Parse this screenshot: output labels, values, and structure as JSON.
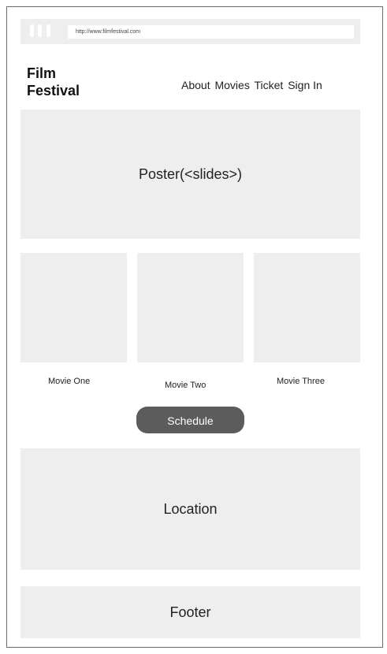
{
  "browser": {
    "url": "http://www.filmfestival.com"
  },
  "header": {
    "logo_line1": "Film",
    "logo_line2": "Festival",
    "nav": [
      "About",
      "Movies",
      "Ticket",
      "Sign In"
    ]
  },
  "poster": {
    "label": "Poster(<slides>)"
  },
  "movies": [
    "Movie One",
    "Movie Two",
    "Movie Three"
  ],
  "schedule_label": "Schedule",
  "location_label": "Location",
  "footer_label": "Footer",
  "colors": {
    "placeholder_bg": "#eeeeee",
    "button_bg": "#5c5c5c",
    "button_text": "#ffffff",
    "frame_border": "#6a6a6a"
  }
}
